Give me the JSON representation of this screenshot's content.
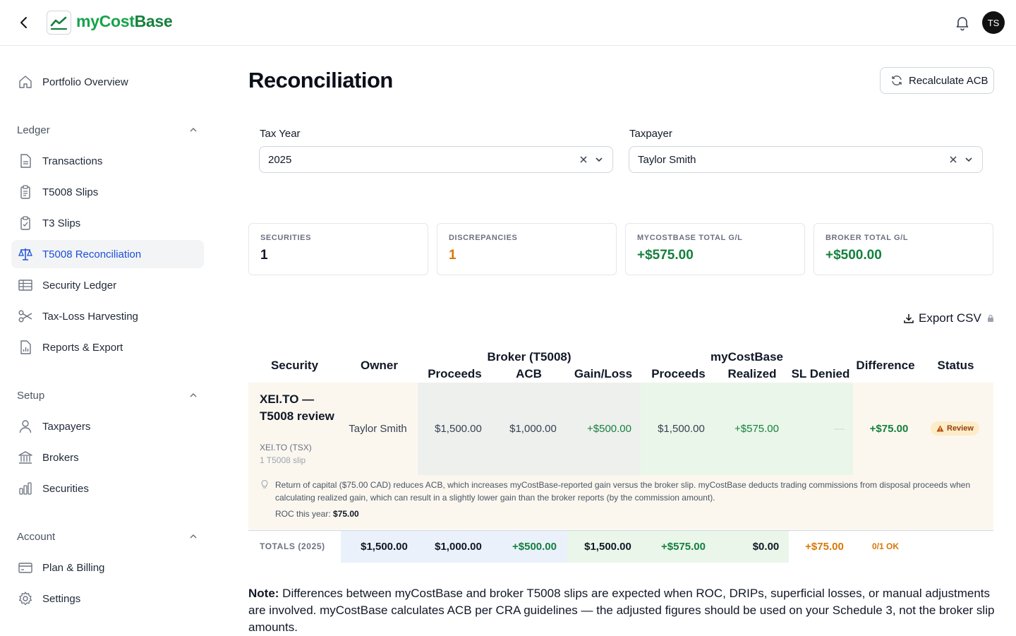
{
  "header": {
    "brand_a": "myCost",
    "brand_b": "Base",
    "avatar_initials": "TS"
  },
  "sidebar": {
    "top_item": "Portfolio Overview",
    "sections": [
      {
        "title": "Ledger",
        "items": [
          "Transactions",
          "T5008 Slips",
          "T3 Slips",
          "T5008 Reconciliation",
          "Security Ledger",
          "Tax-Loss Harvesting",
          "Reports & Export"
        ]
      },
      {
        "title": "Setup",
        "items": [
          "Taxpayers",
          "Brokers",
          "Securities"
        ]
      },
      {
        "title": "Account",
        "items": [
          "Plan & Billing",
          "Settings"
        ]
      }
    ],
    "active_item": "T5008 Reconciliation"
  },
  "main": {
    "title": "Reconciliation",
    "recalc_label": "Recalculate ACB",
    "filters": {
      "tax_year_label": "Tax Year",
      "tax_year_value": "2025",
      "taxpayer_label": "Taxpayer",
      "taxpayer_value": "Taylor Smith"
    },
    "stats": [
      {
        "label": "SECURITIES",
        "value": "1"
      },
      {
        "label": "DISCREPANCIES",
        "value": "1"
      },
      {
        "label": "MYCOSTBASE TOTAL G/L",
        "value": "+$575.00"
      },
      {
        "label": "BROKER TOTAL G/L",
        "value": "+$500.00"
      }
    ],
    "export_label": "Export CSV",
    "table": {
      "group_broker": "Broker (T5008)",
      "group_mcb": "myCostBase",
      "headers": {
        "security": "Security",
        "owner": "Owner",
        "b_proceeds": "Proceeds",
        "b_acb": "ACB",
        "b_gain": "Gain/Loss",
        "m_proceeds": "Proceeds",
        "m_realized": "Realized G/L",
        "m_sl": "SL Denied",
        "difference": "Difference",
        "status": "Status"
      },
      "row": {
        "security": "XEI.TO — T5008 review",
        "ticker": "XEI.TO (TSX)",
        "slips": "1 T5008 slip",
        "owner": "Taylor Smith",
        "b_proceeds": "$1,500.00",
        "b_acb": "$1,000.00",
        "b_gain": "+$500.00",
        "m_proceeds": "$1,500.00",
        "m_realized": "+$575.00",
        "m_sl": "—",
        "difference": "+$75.00",
        "status": "Review",
        "note": "Return of capital ($75.00 CAD) reduces ACB, which increases myCostBase-reported gain versus the broker slip. myCostBase deducts trading commissions from disposal proceeds when calculating realized gain, which can result in a slightly lower gain than the broker reports (by the commission amount).",
        "roc_label": "ROC this year:",
        "roc_value": "$75.00"
      },
      "totals": {
        "label": "TOTALS (2025)",
        "b_proceeds": "$1,500.00",
        "b_acb": "$1,000.00",
        "b_gain": "+$500.00",
        "m_proceeds": "$1,500.00",
        "m_realized": "+$575.00",
        "m_sl": "$0.00",
        "difference": "+$75.00",
        "status": "0/1 OK"
      }
    },
    "note_label": "Note:",
    "note_text": " Differences between myCostBase and broker T5008 slips are expected when ROC, DRIPs, superficial losses, or manual adjustments are involved. myCostBase calculates ACB per CRA guidelines — the adjusted figures should be used on your Schedule 3, not the broker slip amounts."
  }
}
